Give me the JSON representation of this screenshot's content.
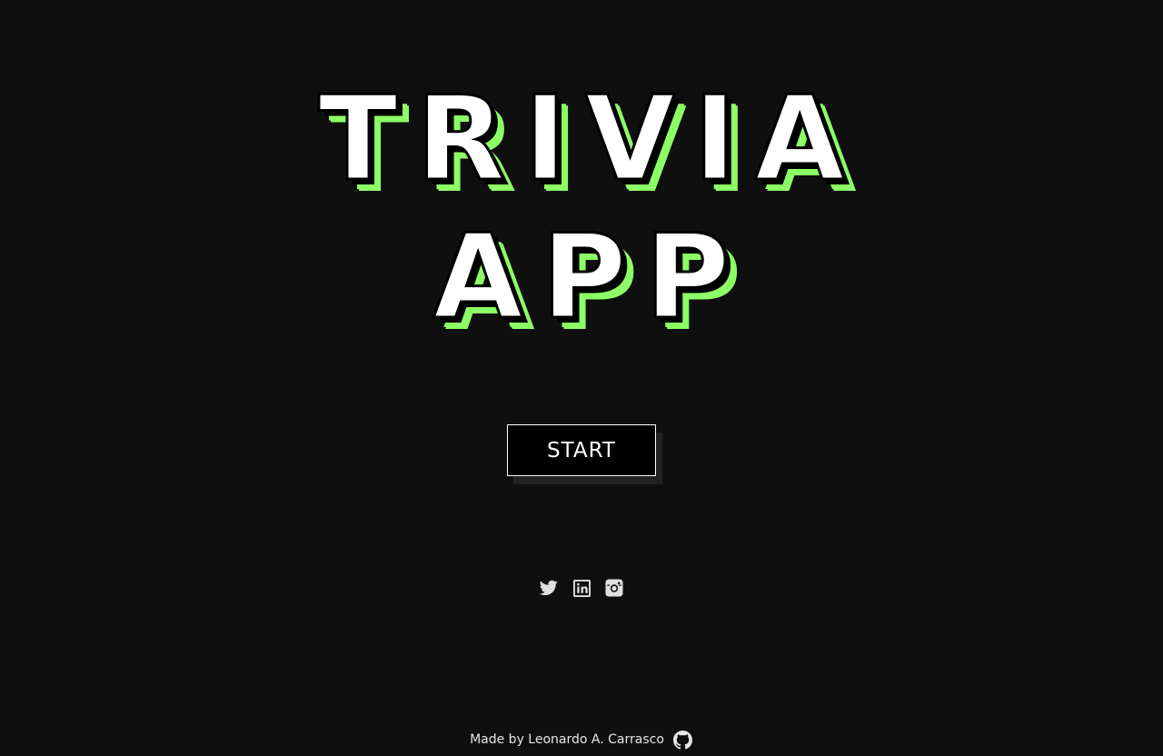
{
  "title": {
    "line1": "TRIVIA",
    "line2": "APP"
  },
  "start_button": {
    "label": "START"
  },
  "social": {
    "icons": [
      "twitter-icon",
      "linkedin-icon",
      "instagram-icon"
    ]
  },
  "footer": {
    "credit": "Made by Leonardo A. Carrasco",
    "icon": "github-icon"
  },
  "colors": {
    "background": "#0f0f0f",
    "accent": "#8cff66",
    "text": "#ffffff",
    "button_bg": "#000000"
  }
}
